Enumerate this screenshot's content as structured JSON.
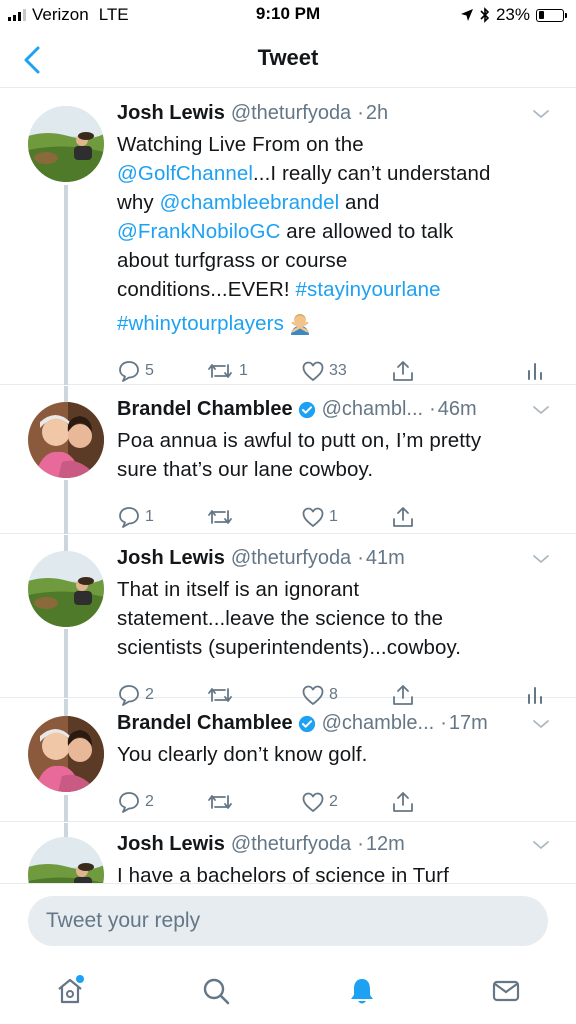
{
  "status_bar": {
    "carrier": "Verizon",
    "network": "LTE",
    "time": "9:10 PM",
    "battery": "23%",
    "battery_level": 0.23
  },
  "nav": {
    "title": "Tweet",
    "back_icon": "chevron-left-icon"
  },
  "colors": {
    "accent": "#1da1f2",
    "text": "#14171a",
    "muted": "#657786",
    "divider": "#e6ecf0"
  },
  "tweets": [
    {
      "name": "Josh Lewis",
      "handle": "@theturfyoda",
      "time": "2h",
      "verified": false,
      "lines": [
        [
          "Watching Live From on the"
        ],
        [
          {
            "m": "@GolfChannel"
          },
          "...I really can’t understand"
        ],
        [
          "why ",
          {
            "m": "@chambleebrandel"
          },
          " and"
        ],
        [
          {
            "m": "@FrankNobiloGC"
          },
          " are allowed to talk"
        ],
        [
          "about turfgrass or course"
        ],
        [
          "conditions...EVER! ",
          {
            "m": "#stayinyourlane"
          }
        ],
        [
          {
            "m": "#whinytourplayers"
          },
          {
            "emoji": "man-gesturing-no"
          }
        ]
      ],
      "actions": {
        "reply": "5",
        "retweet": "1",
        "like": "33",
        "analytics": true
      }
    },
    {
      "name": "Brandel Chamblee",
      "handle": "@chambl...",
      "time": "46m",
      "verified": true,
      "lines": [
        [
          "Poa annua is awful to putt on, I’m pretty"
        ],
        [
          "sure that’s our lane cowboy."
        ]
      ],
      "actions": {
        "reply": "1",
        "retweet": "",
        "like": "1",
        "analytics": false
      }
    },
    {
      "name": "Josh Lewis",
      "handle": "@theturfyoda",
      "time": "41m",
      "verified": false,
      "lines": [
        [
          "That in itself is an ignorant"
        ],
        [
          "statement...leave the science to the"
        ],
        [
          "scientists (superintendents)...cowboy."
        ]
      ],
      "actions": {
        "reply": "2",
        "retweet": "",
        "like": "8",
        "analytics": true
      }
    },
    {
      "name": "Brandel Chamblee",
      "handle": "@chamble...",
      "time": "17m",
      "verified": true,
      "lines": [
        [
          "You clearly don’t know golf."
        ]
      ],
      "actions": {
        "reply": "2",
        "retweet": "",
        "like": "2",
        "analytics": false
      }
    },
    {
      "name": "Josh Lewis",
      "handle": "@theturfyoda",
      "time": "12m",
      "verified": false,
      "lines": [
        [
          "I have a bachelors of science in Turf"
        ]
      ],
      "actions": null
    }
  ],
  "reply": {
    "placeholder": "Tweet your reply"
  },
  "tab_bar": {
    "items": [
      "home-icon",
      "search-icon",
      "notifications-icon",
      "messages-icon"
    ],
    "active": "notifications-icon"
  }
}
